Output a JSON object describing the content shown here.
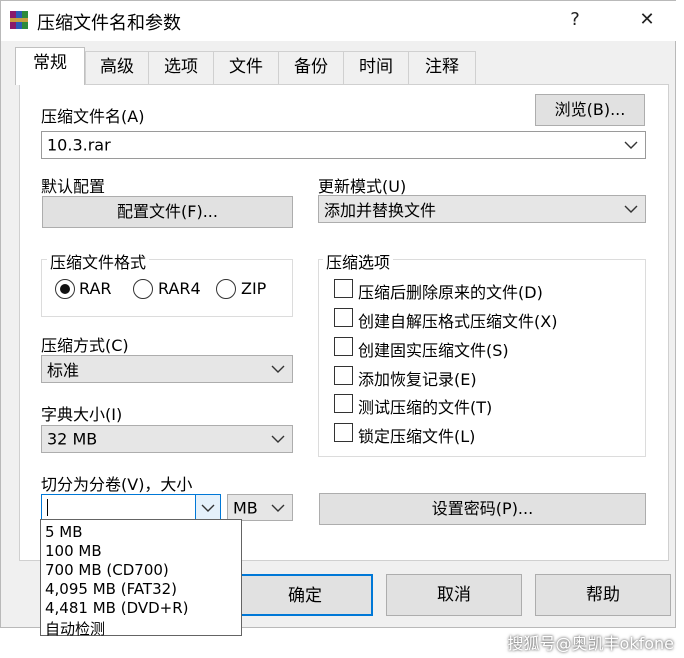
{
  "window": {
    "title": "压缩文件名和参数",
    "help_glyph": "?",
    "close_glyph": "✕"
  },
  "tabs": [
    "常规",
    "高级",
    "选项",
    "文件",
    "备份",
    "时间",
    "注释"
  ],
  "archive_name": {
    "label": "压缩文件名(A)",
    "value": "10.3.rar",
    "browse_label": "浏览(B)..."
  },
  "profile": {
    "label": "默认配置",
    "button_label": "配置文件(F)..."
  },
  "update_mode": {
    "label": "更新模式(U)",
    "value": "添加并替换文件"
  },
  "archive_format": {
    "title": "压缩文件格式",
    "options": [
      "RAR",
      "RAR4",
      "ZIP"
    ],
    "selected": "RAR"
  },
  "archive_options": {
    "title": "压缩选项",
    "items": [
      {
        "label": "压缩后删除原来的文件(D)",
        "checked": false
      },
      {
        "label": "创建自解压格式压缩文件(X)",
        "checked": false
      },
      {
        "label": "创建固实压缩文件(S)",
        "checked": false
      },
      {
        "label": "添加恢复记录(E)",
        "checked": false
      },
      {
        "label": "测试压缩的文件(T)",
        "checked": false
      },
      {
        "label": "锁定压缩文件(L)",
        "checked": false
      }
    ]
  },
  "compression_method": {
    "label": "压缩方式(C)",
    "value": "标准"
  },
  "dictionary_size": {
    "label": "字典大小(I)",
    "value": "32 MB"
  },
  "split_volumes": {
    "label": "切分为分卷(V)，大小",
    "value": "",
    "unit": "MB",
    "options": [
      "5 MB",
      "100 MB",
      "700 MB (CD700)",
      "4,095 MB (FAT32)",
      "4,481 MB (DVD+R)",
      "自动检测"
    ]
  },
  "set_password_label": "设置密码(P)...",
  "buttons": {
    "ok": "确定",
    "cancel": "取消",
    "help": "帮助"
  },
  "watermark": "搜狐号@奥凯丰okfone"
}
